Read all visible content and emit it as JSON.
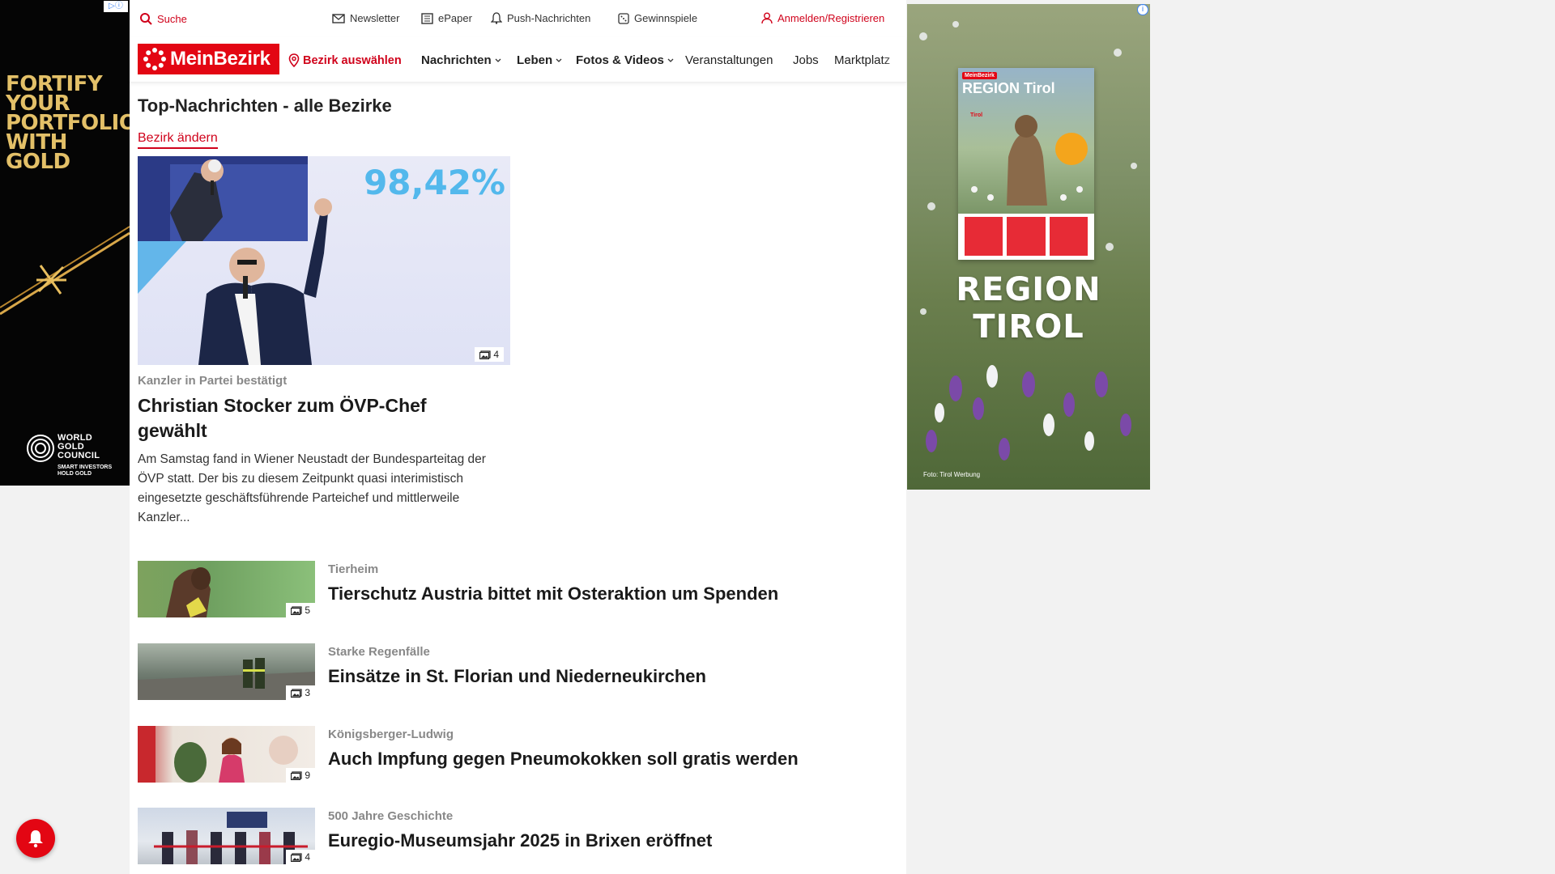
{
  "ads": {
    "left": {
      "badge": "▷ⓘ",
      "headline": "FORTIFY YOUR PORTFOLIO WITH GOLD",
      "brand": "WORLD GOLD COUNCIL",
      "slogan": "SMART INVESTORS HOLD GOLD"
    },
    "right": {
      "info": "i",
      "magazine_brand": "MeinBezirk",
      "magazine_title": "REGION Tirol",
      "magazine_sub": "Tirol",
      "headline": "REGION TIROL",
      "credit": "Foto: Tirol Werbung"
    }
  },
  "topbar": {
    "search": "Suche",
    "newsletter": "Newsletter",
    "epaper": "ePaper",
    "push": "Push-Nachrichten",
    "games": "Gewinnspiele",
    "login": "Anmelden/Registrieren"
  },
  "nav": {
    "logo": "MeinBezirk",
    "bezirk": "Bezirk auswählen",
    "items": [
      "Nachrichten",
      "Leben",
      "Fotos & Videos",
      "Veranstaltungen",
      "Jobs",
      "Marktplatz"
    ]
  },
  "section": {
    "title": "Top-Nachrichten - alle Bezirke",
    "change": "Bezirk ändern"
  },
  "hero": {
    "percent": "98,42%",
    "image_count": "4",
    "kicker": "Kanzler in Partei bestätigt",
    "title": "Christian Stocker zum ÖVP-Chef gewählt",
    "teaser": "Am Samstag fand in Wiener Neustadt der Bundesparteitag der ÖVP statt. Der bis zu diesem Zeitpunkt quasi interimistisch eingesetzte geschäftsführende Parteichef und mittlerweile Kanzler..."
  },
  "articles": [
    {
      "kicker": "Tierheim",
      "title": "Tierschutz Austria bittet mit Osteraktion um Spenden",
      "count": "5"
    },
    {
      "kicker": "Starke Regenfälle",
      "title": "Einsätze in St. Florian und Niederneukirchen",
      "count": "3"
    },
    {
      "kicker": "Königsberger-Ludwig",
      "title": "Auch Impfung gegen Pneumokokken soll gratis werden",
      "count": "9"
    },
    {
      "kicker": "500 Jahre Geschichte",
      "title": "Euregio-Museumsjahr 2025 in Brixen eröffnet",
      "count": "4"
    }
  ],
  "colors": {
    "brand_red": "#e30613",
    "link_red": "#d0021b",
    "percent_blue": "#53b8ec",
    "gold": "#e3c068"
  }
}
